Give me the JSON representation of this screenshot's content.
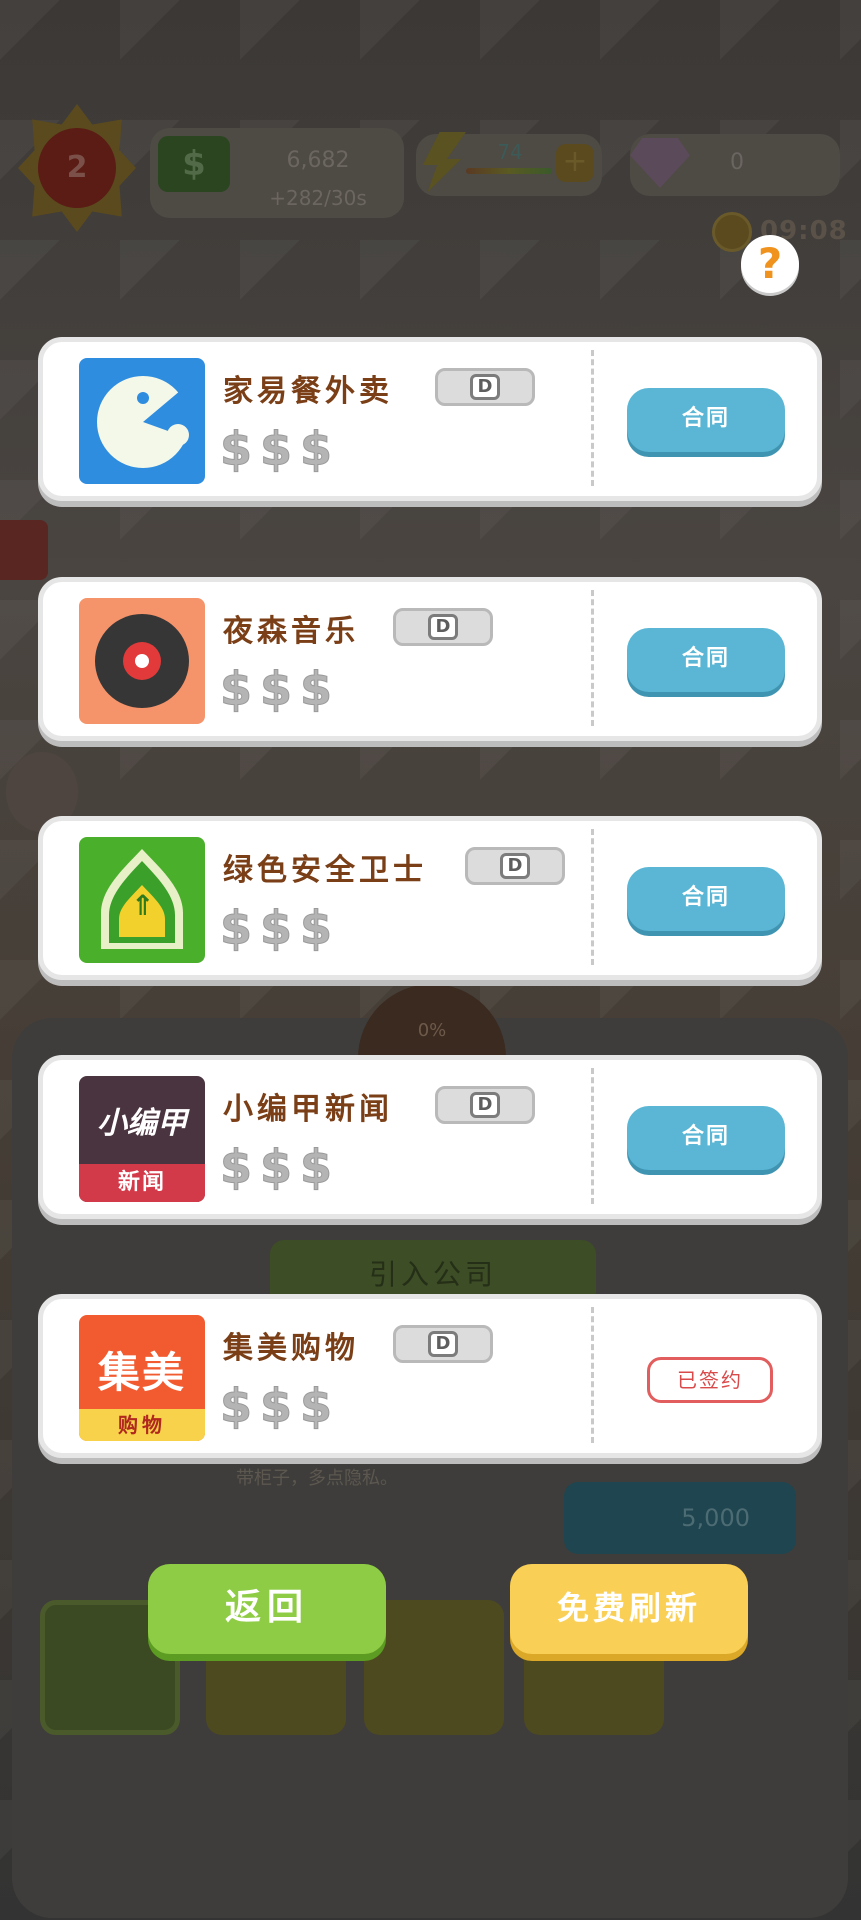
{
  "hud": {
    "level": "2",
    "money": "6,682",
    "money_rate": "+282/30s",
    "energy": "74",
    "gems": "0",
    "timer": "09:08",
    "help_label": "?"
  },
  "background": {
    "import_company_label": "引入公司",
    "desc_text": "带柜子，多点隐私。",
    "price": "5,000",
    "progress": "0%"
  },
  "contracts": [
    {
      "name": "家易餐外卖",
      "grade": "D",
      "dollars": [
        "$",
        "$",
        "$"
      ],
      "action": "合同",
      "status": "available",
      "logo": "pacman-icon"
    },
    {
      "name": "夜森音乐",
      "grade": "D",
      "dollars": [
        "$",
        "$",
        "$"
      ],
      "action": "合同",
      "status": "available",
      "logo": "vinyl-record-icon"
    },
    {
      "name": "绿色安全卫士",
      "grade": "D",
      "dollars": [
        "$",
        "$",
        "$"
      ],
      "action": "合同",
      "status": "available",
      "logo": "shield-icon"
    },
    {
      "name": "小编甲新闻",
      "grade": "D",
      "dollars": [
        "$",
        "$",
        "$"
      ],
      "action": "合同",
      "status": "available",
      "logo": "news-logo",
      "logo_text_top": "小编甲",
      "logo_text_bottom": "新闻"
    },
    {
      "name": "集美购物",
      "grade": "D",
      "dollars": [
        "$",
        "$",
        "$"
      ],
      "action": "已签约",
      "status": "signed",
      "logo": "shop-logo",
      "logo_text_top": "集美",
      "logo_text_bottom": "购物"
    }
  ],
  "buttons": {
    "back": "返回",
    "refresh": "免费刷新"
  },
  "colors": {
    "card_bg": "#ffffff",
    "name_text": "#7a3f17",
    "contract_button": "#5ab6d4",
    "signed_border": "#e25e5e",
    "back_button": "#8fcc45",
    "refresh_button": "#f9cf55"
  }
}
